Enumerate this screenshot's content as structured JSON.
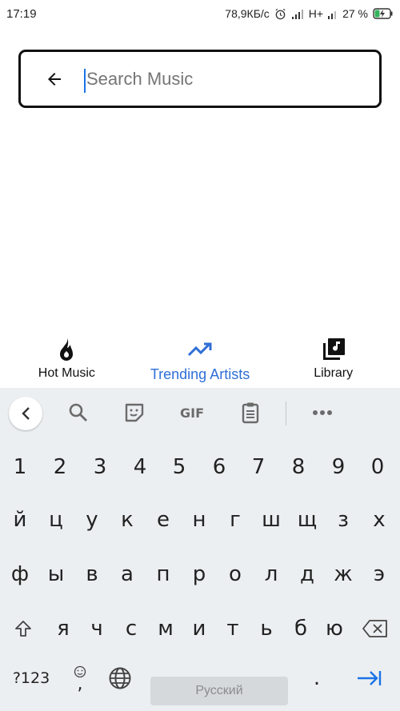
{
  "status_bar": {
    "time": "17:19",
    "net_speed": "78,9КБ/с",
    "network": "H+",
    "battery": "27 %"
  },
  "search": {
    "placeholder": "Search Music"
  },
  "bottom_nav": {
    "items": [
      {
        "label": "Hot Music",
        "icon": "flame-icon",
        "active": false
      },
      {
        "label": "Trending Artists",
        "icon": "trending-up-icon",
        "active": true
      },
      {
        "label": "Library",
        "icon": "library-music-icon",
        "active": false
      }
    ],
    "active_color": "#2f6fd6"
  },
  "keyboard": {
    "toolbar": [
      "collapse-icon",
      "search-icon",
      "sticker-icon",
      "GIF",
      "clipboard-icon",
      "more-icon"
    ],
    "gif_label": "GIF",
    "number_row": [
      "1",
      "2",
      "3",
      "4",
      "5",
      "6",
      "7",
      "8",
      "9",
      "0"
    ],
    "row1": [
      "й",
      "ц",
      "у",
      "к",
      "е",
      "н",
      "г",
      "ш",
      "щ",
      "з",
      "х"
    ],
    "row2": [
      "ф",
      "ы",
      "в",
      "а",
      "п",
      "р",
      "о",
      "л",
      "д",
      "ж",
      "э"
    ],
    "row3": [
      "я",
      "ч",
      "с",
      "м",
      "и",
      "т",
      "ь",
      "б",
      "ю"
    ],
    "symbols_label": "?123",
    "comma": ",",
    "space_label": "Русский",
    "period": ".",
    "enter_color": "#1a73e8"
  }
}
